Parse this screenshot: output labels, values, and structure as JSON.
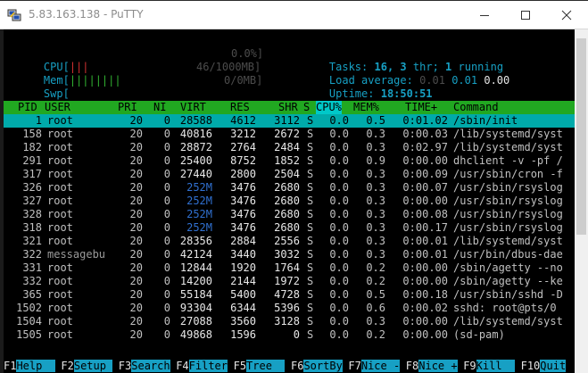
{
  "window": {
    "title": "5.83.163.138 - PuTTY"
  },
  "meters": {
    "cpu_label": "CPU[",
    "cpu_bar": "|||",
    "cpu_value": "0.0%]",
    "mem_label": "Mem[",
    "mem_bar": "||||||||",
    "mem_value": "46/1000MB]",
    "swp_label": "Swp[",
    "swp_value": "0/0MB]"
  },
  "stats": {
    "tasks_label": "Tasks:",
    "tasks_value": "16,",
    "thr_value": "3",
    "thr_label": "thr;",
    "running_value": "1",
    "running_label": "running",
    "load_label": "Load average:",
    "load1": "0.01",
    "load5": "0.01",
    "load15": "0.00",
    "uptime_label": "Uptime:",
    "uptime_value": "18:50:51"
  },
  "columns": [
    "PID",
    "USER",
    "PRI",
    "NI",
    "VIRT",
    "RES",
    "SHR",
    "S",
    "CPU%",
    "MEM%",
    "TIME+",
    "Command"
  ],
  "processes": [
    {
      "pid": "1",
      "user": "root",
      "pri": "20",
      "ni": "0",
      "virt": "28588",
      "res": "4612",
      "shr": "3112",
      "s": "S",
      "cpu": "0.0",
      "mem": "0.5",
      "time": "0:01.02",
      "cmd": "/sbin/init"
    },
    {
      "pid": "158",
      "user": "root",
      "pri": "20",
      "ni": "0",
      "virt": "40816",
      "res": "3212",
      "shr": "2672",
      "s": "S",
      "cpu": "0.0",
      "mem": "0.3",
      "time": "0:00.03",
      "cmd": "/lib/systemd/syst"
    },
    {
      "pid": "182",
      "user": "root",
      "pri": "20",
      "ni": "0",
      "virt": "28872",
      "res": "2764",
      "shr": "2484",
      "s": "S",
      "cpu": "0.0",
      "mem": "0.3",
      "time": "0:02.97",
      "cmd": "/lib/systemd/syst"
    },
    {
      "pid": "291",
      "user": "root",
      "pri": "20",
      "ni": "0",
      "virt": "25400",
      "res": "8752",
      "shr": "1852",
      "s": "S",
      "cpu": "0.0",
      "mem": "0.9",
      "time": "0:00.00",
      "cmd": "dhclient -v -pf /"
    },
    {
      "pid": "317",
      "user": "root",
      "pri": "20",
      "ni": "0",
      "virt": "27440",
      "res": "2800",
      "shr": "2504",
      "s": "S",
      "cpu": "0.0",
      "mem": "0.3",
      "time": "0:00.09",
      "cmd": "/usr/sbin/cron -f"
    },
    {
      "pid": "326",
      "user": "root",
      "pri": "20",
      "ni": "0",
      "virt": "252M",
      "res": "3476",
      "shr": "2680",
      "s": "S",
      "cpu": "0.0",
      "mem": "0.3",
      "time": "0:00.07",
      "cmd": "/usr/sbin/rsyslog"
    },
    {
      "pid": "327",
      "user": "root",
      "pri": "20",
      "ni": "0",
      "virt": "252M",
      "res": "3476",
      "shr": "2680",
      "s": "S",
      "cpu": "0.0",
      "mem": "0.3",
      "time": "0:00.00",
      "cmd": "/usr/sbin/rsyslog"
    },
    {
      "pid": "328",
      "user": "root",
      "pri": "20",
      "ni": "0",
      "virt": "252M",
      "res": "3476",
      "shr": "2680",
      "s": "S",
      "cpu": "0.0",
      "mem": "0.3",
      "time": "0:00.08",
      "cmd": "/usr/sbin/rsyslog"
    },
    {
      "pid": "318",
      "user": "root",
      "pri": "20",
      "ni": "0",
      "virt": "252M",
      "res": "3476",
      "shr": "2680",
      "s": "S",
      "cpu": "0.0",
      "mem": "0.3",
      "time": "0:00.17",
      "cmd": "/usr/sbin/rsyslog"
    },
    {
      "pid": "321",
      "user": "root",
      "pri": "20",
      "ni": "0",
      "virt": "28356",
      "res": "2884",
      "shr": "2556",
      "s": "S",
      "cpu": "0.0",
      "mem": "0.3",
      "time": "0:00.01",
      "cmd": "/lib/systemd/syst"
    },
    {
      "pid": "322",
      "user": "messagebu",
      "pri": "20",
      "ni": "0",
      "virt": "42124",
      "res": "3440",
      "shr": "3032",
      "s": "S",
      "cpu": "0.0",
      "mem": "0.3",
      "time": "0:00.01",
      "cmd": "/usr/bin/dbus-dae"
    },
    {
      "pid": "331",
      "user": "root",
      "pri": "20",
      "ni": "0",
      "virt": "12844",
      "res": "1920",
      "shr": "1764",
      "s": "S",
      "cpu": "0.0",
      "mem": "0.2",
      "time": "0:00.00",
      "cmd": "/sbin/agetty --no"
    },
    {
      "pid": "332",
      "user": "root",
      "pri": "20",
      "ni": "0",
      "virt": "14200",
      "res": "2144",
      "shr": "1972",
      "s": "S",
      "cpu": "0.0",
      "mem": "0.2",
      "time": "0:00.00",
      "cmd": "/sbin/agetty --ke"
    },
    {
      "pid": "365",
      "user": "root",
      "pri": "20",
      "ni": "0",
      "virt": "55184",
      "res": "5400",
      "shr": "4728",
      "s": "S",
      "cpu": "0.0",
      "mem": "0.5",
      "time": "0:00.18",
      "cmd": "/usr/sbin/sshd -D"
    },
    {
      "pid": "1502",
      "user": "root",
      "pri": "20",
      "ni": "0",
      "virt": "93304",
      "res": "6344",
      "shr": "5396",
      "s": "S",
      "cpu": "0.0",
      "mem": "0.6",
      "time": "0:00.02",
      "cmd": "sshd: root@pts/0"
    },
    {
      "pid": "1504",
      "user": "root",
      "pri": "20",
      "ni": "0",
      "virt": "27088",
      "res": "3560",
      "shr": "3128",
      "s": "S",
      "cpu": "0.0",
      "mem": "0.3",
      "time": "0:00.00",
      "cmd": "/lib/systemd/syst"
    },
    {
      "pid": "1505",
      "user": "root",
      "pri": "20",
      "ni": "0",
      "virt": "49868",
      "res": "1596",
      "shr": "0",
      "s": "S",
      "cpu": "0.0",
      "mem": "0.2",
      "time": "0:00.00",
      "cmd": "(sd-pam)"
    }
  ],
  "function_keys": [
    {
      "key": "F1",
      "label": "Help  "
    },
    {
      "key": "F2",
      "label": "Setup "
    },
    {
      "key": "F3",
      "label": "Search"
    },
    {
      "key": "F4",
      "label": "Filter"
    },
    {
      "key": "F5",
      "label": "Tree  "
    },
    {
      "key": "F6",
      "label": "SortBy"
    },
    {
      "key": "F7",
      "label": "Nice -"
    },
    {
      "key": "F8",
      "label": "Nice +"
    },
    {
      "key": "F9",
      "label": "Kill  "
    },
    {
      "key": "F10",
      "label": "Quit"
    }
  ]
}
